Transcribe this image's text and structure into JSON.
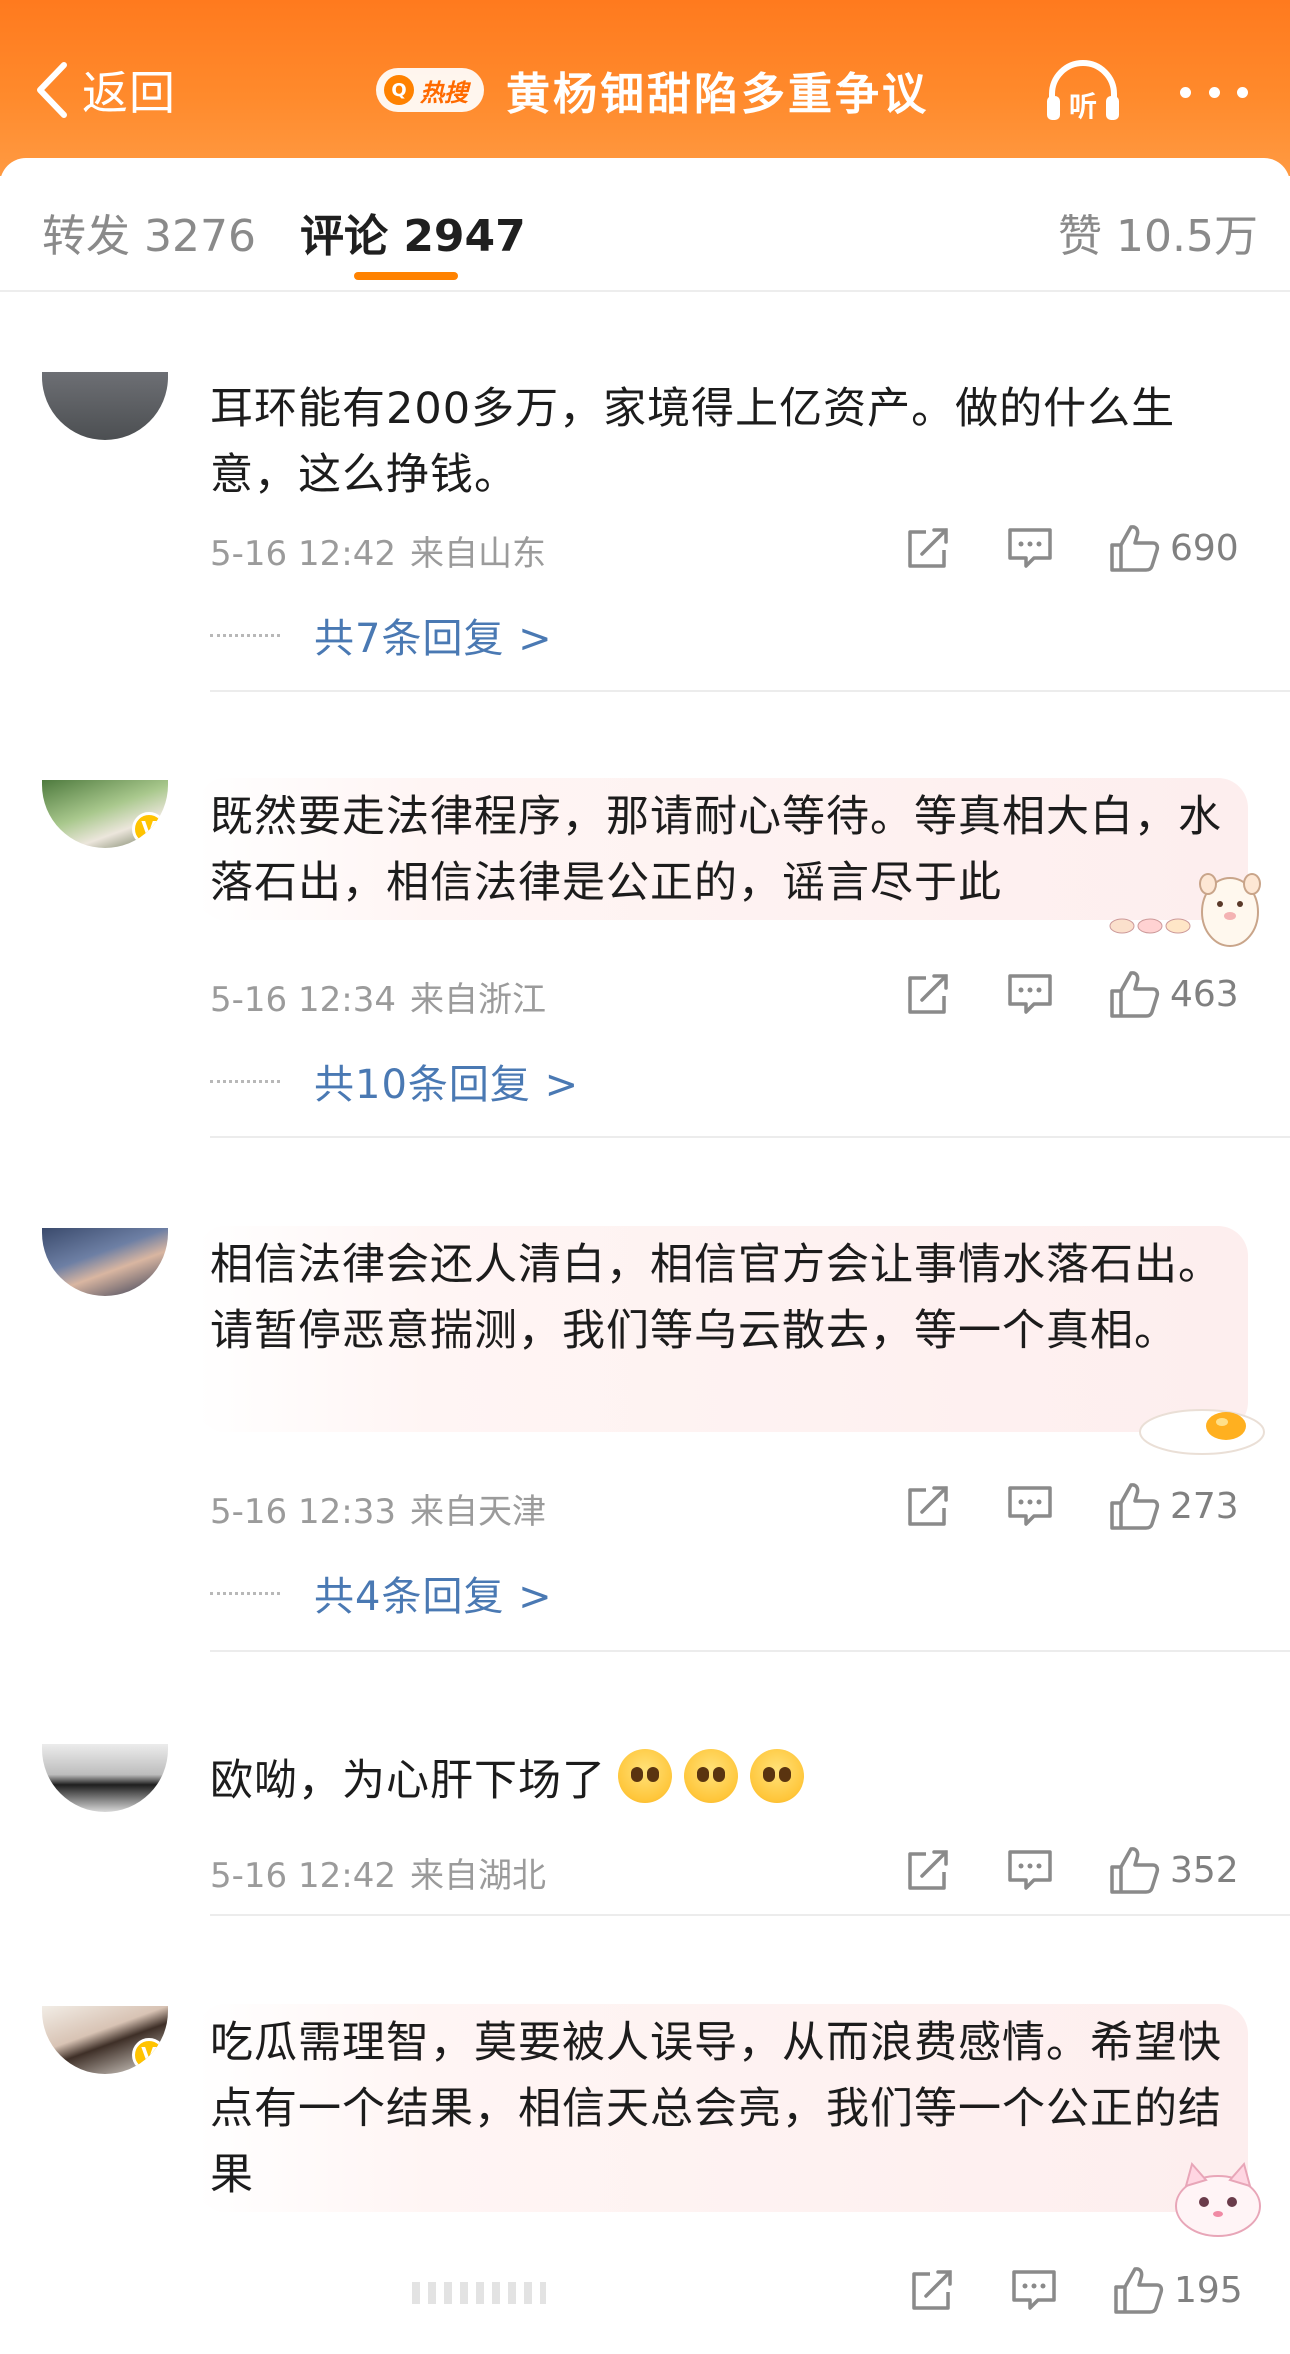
{
  "header": {
    "back_label": "返回",
    "hot_badge": "热搜",
    "title": "黄杨钿甜陷多重争议",
    "listen_label": "听"
  },
  "tabs": {
    "repost": "转发 3276",
    "comments": "评论 2947",
    "likes": "赞 10.5万"
  },
  "comments": [
    {
      "text": "耳环能有200多万，家境得上亿资产。做的什么生意，这么挣钱。",
      "time": "5-16 12:42",
      "location": "来自山东",
      "likes": "690",
      "replies": "共7条回复 >"
    },
    {
      "text": "既然要走法律程序，那请耐心等待。等真相大白，水落石出，相信法律是公正的，谣言尽于此",
      "time": "5-16 12:34",
      "location": "来自浙江",
      "likes": "463",
      "replies": "共10条回复 >"
    },
    {
      "text": "相信法律会还人清白，相信官方会让事情水落石出。请暂停恶意揣测，我们等乌云散去，等一个真相。",
      "time": "5-16 12:33",
      "location": "来自天津",
      "likes": "273",
      "replies": "共4条回复 >"
    },
    {
      "text": "欧呦，为心肝下场了",
      "time": "5-16 12:42",
      "location": "来自湖北",
      "likes": "352",
      "replies": ""
    },
    {
      "text": "吃瓜需理智，莫要被人误导，从而浪费感情。希望快点有一个结果，相信天总会亮，我们等一个公正的结果",
      "time": "",
      "location": "",
      "likes": "195",
      "replies": ""
    }
  ],
  "colors": {
    "header_orange": "#ff8a2c",
    "accent": "#ff8200",
    "link_blue": "#4a79b3",
    "verified_badge": "#ffc300"
  },
  "icons": [
    "chevron-left-icon",
    "search-icon",
    "headphones-icon",
    "more-icon",
    "share-icon",
    "comment-icon",
    "like-icon",
    "verified-icon"
  ]
}
